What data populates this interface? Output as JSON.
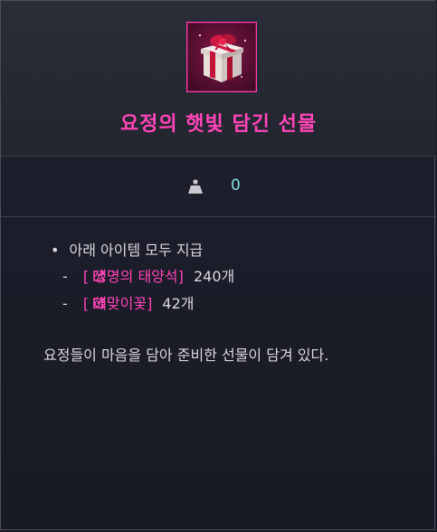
{
  "item": {
    "name": "요정의 햇빛 담긴 선물",
    "icon": "gift-box-icon",
    "weight_icon": "weight-icon",
    "weight_value": "0",
    "accent_color": "#ff45b8",
    "value_color": "#7fe0dc"
  },
  "contents": {
    "header": "아래 아이템 모두 지급",
    "bullet": "•",
    "dash": "-",
    "items": [
      {
        "name": "[  생명의 태양석]",
        "quantity": "240개"
      },
      {
        "name": "[  해맞이꽃]",
        "quantity": "42개"
      }
    ]
  },
  "description": "요정들이 마음을 담아 준비한 선물이 담겨 있다."
}
